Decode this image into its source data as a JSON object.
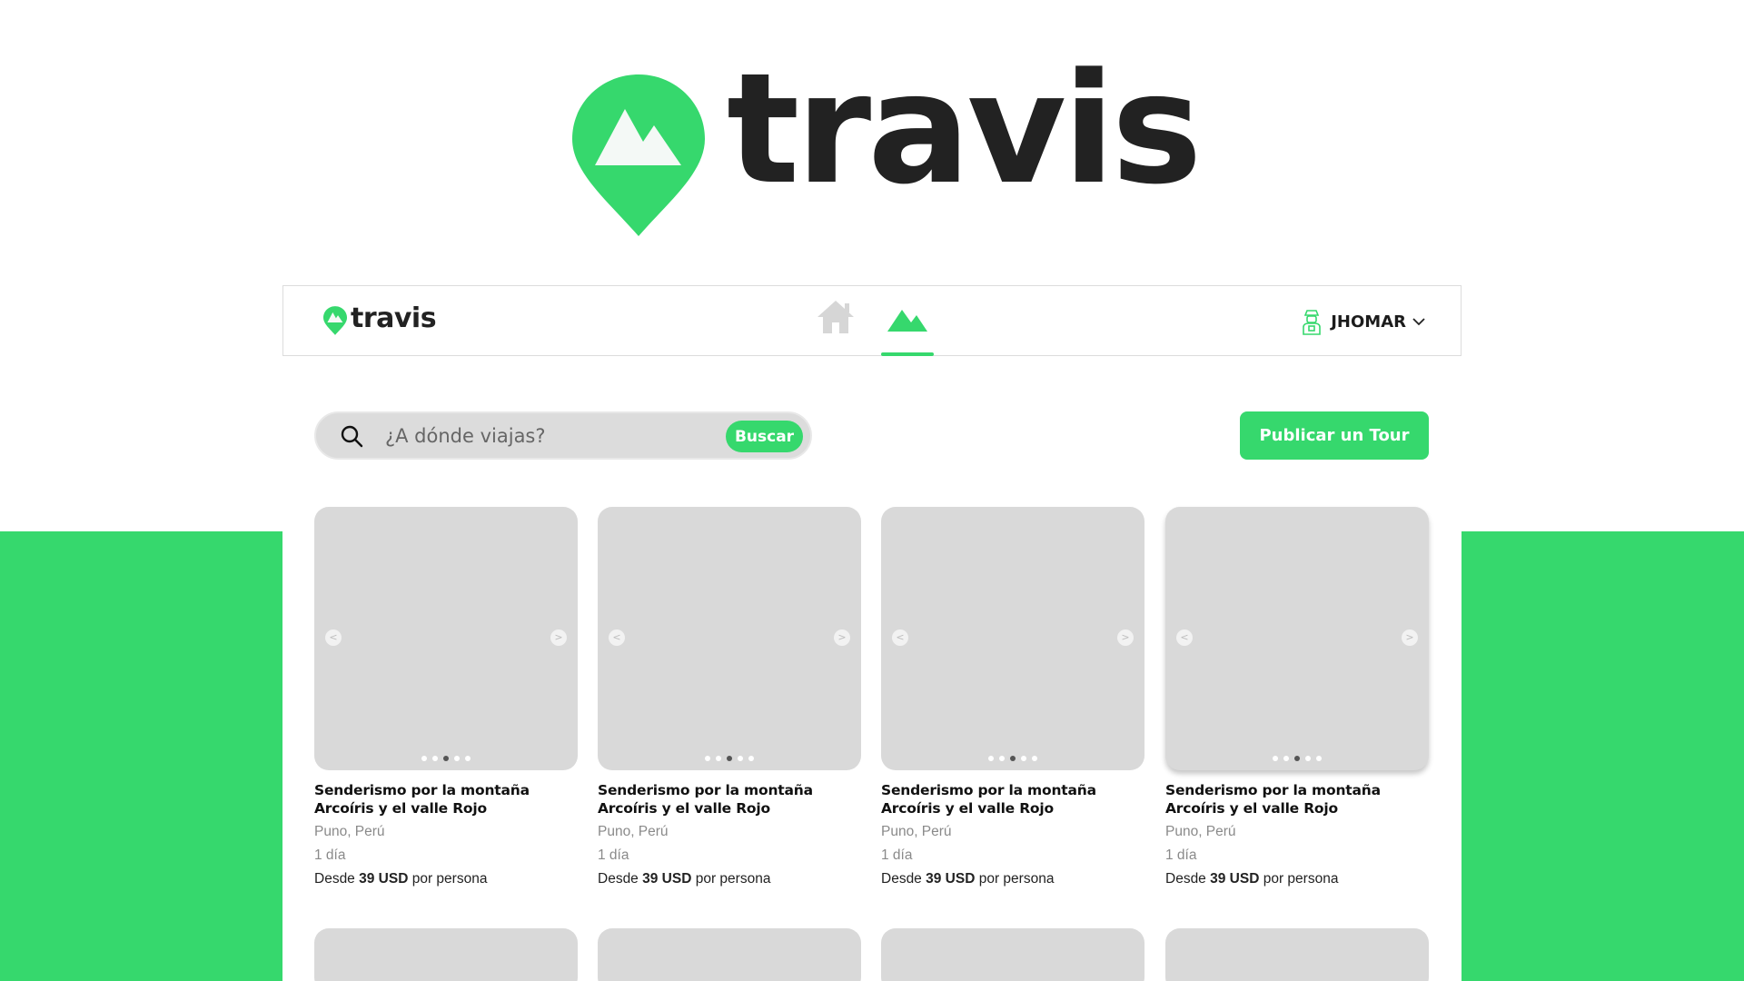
{
  "brand": {
    "name": "travis",
    "color": "#36d86d",
    "logo_icon": "map-pin-mountain-icon"
  },
  "nav": {
    "logo_text": "travis",
    "items": [
      {
        "name": "home",
        "icon": "home-icon",
        "active": false
      },
      {
        "name": "tours",
        "icon": "mountain-icon",
        "active": true
      }
    ],
    "user": {
      "name": "JHOMAR",
      "icon": "explorer-avatar-icon"
    }
  },
  "search": {
    "placeholder": "¿A dónde viajas?",
    "button_label": "Buscar"
  },
  "publish_label": "Publicar un Tour",
  "cards": [
    {
      "title": "Senderismo por la montaña Arcoíris y el valle Rojo",
      "location": "Puno, Perú",
      "duration": "1 día",
      "price_prefix": "Desde",
      "price": "39 USD",
      "price_suffix": "por persona",
      "active_dot": 2
    },
    {
      "title": "Senderismo por la montaña Arcoíris y el valle Rojo",
      "location": "Puno, Perú",
      "duration": "1 día",
      "price_prefix": "Desde",
      "price": "39 USD",
      "price_suffix": "por persona",
      "active_dot": 2
    },
    {
      "title": "Senderismo por la montaña Arcoíris y el valle Rojo",
      "location": "Puno, Perú",
      "duration": "1 día",
      "price_prefix": "Desde",
      "price": "39 USD",
      "price_suffix": "por persona",
      "active_dot": 2
    },
    {
      "title": "Senderismo por la montaña Arcoíris y el valle Rojo",
      "location": "Puno, Perú",
      "duration": "1 día",
      "price_prefix": "Desde",
      "price": "39 USD",
      "price_suffix": "por persona",
      "active_dot": 2
    }
  ],
  "carousel_arrows": {
    "prev": "<",
    "next": ">"
  }
}
